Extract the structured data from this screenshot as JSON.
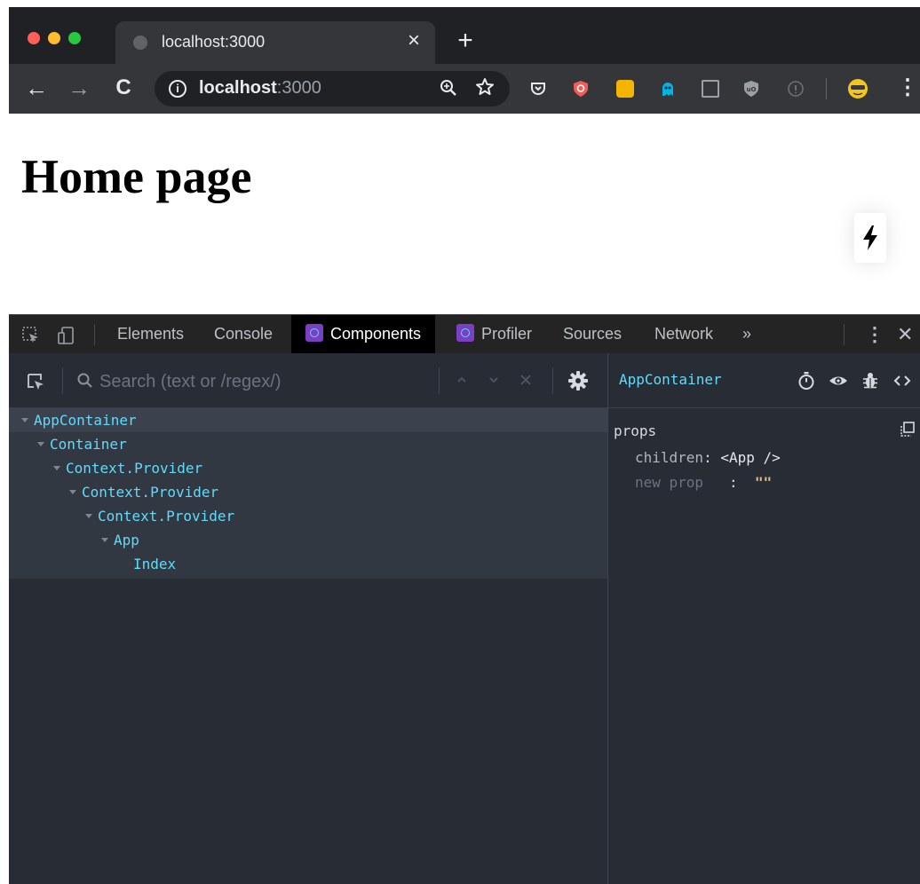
{
  "browser": {
    "tab": {
      "title": "localhost:3000",
      "close": "×"
    },
    "new_tab": "+",
    "nav": {
      "back": "←",
      "forward": "→",
      "reload": "C"
    },
    "address": {
      "host": "localhost",
      "port": ":3000",
      "info": "i"
    }
  },
  "page": {
    "heading": "Home page"
  },
  "devtools": {
    "tabs": [
      "Elements",
      "Console",
      "Components",
      "Profiler",
      "Sources",
      "Network",
      "»"
    ],
    "active_tab": "Components",
    "search": {
      "placeholder": "Search (text or /regex/)"
    },
    "tree": [
      {
        "label": "AppContainer",
        "expanded": true,
        "selected": true
      },
      {
        "label": "Container",
        "expanded": true
      },
      {
        "label": "Context.Provider",
        "expanded": true
      },
      {
        "label": "Context.Provider",
        "expanded": true
      },
      {
        "label": "Context.Provider",
        "expanded": true
      },
      {
        "label": "App",
        "expanded": true
      },
      {
        "label": "Index",
        "expanded": false
      }
    ],
    "inspector": {
      "component": "AppContainer",
      "section": "props",
      "props": [
        {
          "key": "children",
          "value": "<App />"
        },
        {
          "key": "new prop",
          "value": "\"\""
        }
      ]
    }
  }
}
